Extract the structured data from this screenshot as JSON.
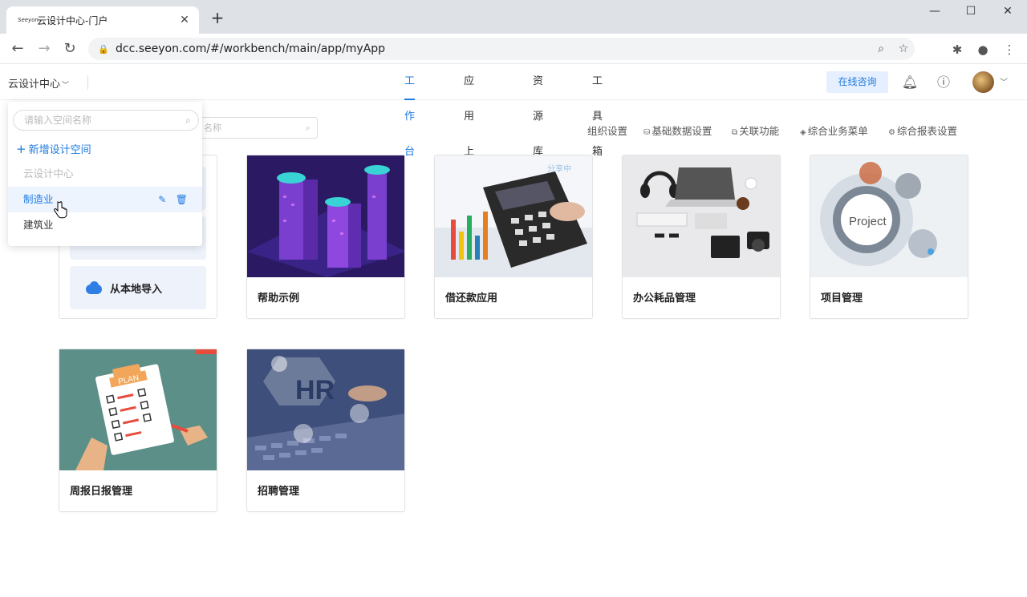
{
  "browser": {
    "tab_title": "云设计中心-门户",
    "favicon_text": "Seeyon",
    "url": "dcc.seeyon.com/#/workbench/main/app/myApp"
  },
  "header": {
    "space_selector": "云设计中心",
    "nav": [
      "工作台",
      "应用上架",
      "资源库",
      "工具箱"
    ],
    "active_nav": "工作台",
    "consult_label": "在线咨询"
  },
  "subbar": {
    "search_placeholder_visible": "名称",
    "links": [
      "组织设置",
      "基础数据设置",
      "关联功能",
      "综合业务菜单",
      "综合报表设置"
    ]
  },
  "dropdown": {
    "search_placeholder": "请输入空间名称",
    "add_label": "新增设计空间",
    "items": [
      {
        "label": "云设计中心",
        "state": "current"
      },
      {
        "label": "制造业",
        "state": "hover"
      },
      {
        "label": "建筑业",
        "state": "normal"
      }
    ]
  },
  "import_card": {
    "local_import_label": "从本地导入"
  },
  "apps": [
    {
      "name": "帮助示例",
      "image": "isometric-city"
    },
    {
      "name": "借还款应用",
      "image": "calculator-charts",
      "badge": "分享中"
    },
    {
      "name": "办公耗品管理",
      "image": "office-desk"
    },
    {
      "name": "项目管理",
      "image": "project-gears",
      "image_text": "Project"
    },
    {
      "name": "周报日报管理",
      "image": "plan-clipboard",
      "image_text": "PLAN"
    },
    {
      "name": "招聘管理",
      "image": "hr-keyboard",
      "image_text": "HR"
    }
  ],
  "colors": {
    "accent": "#1f7be0",
    "consult_bg": "#e6efff"
  }
}
